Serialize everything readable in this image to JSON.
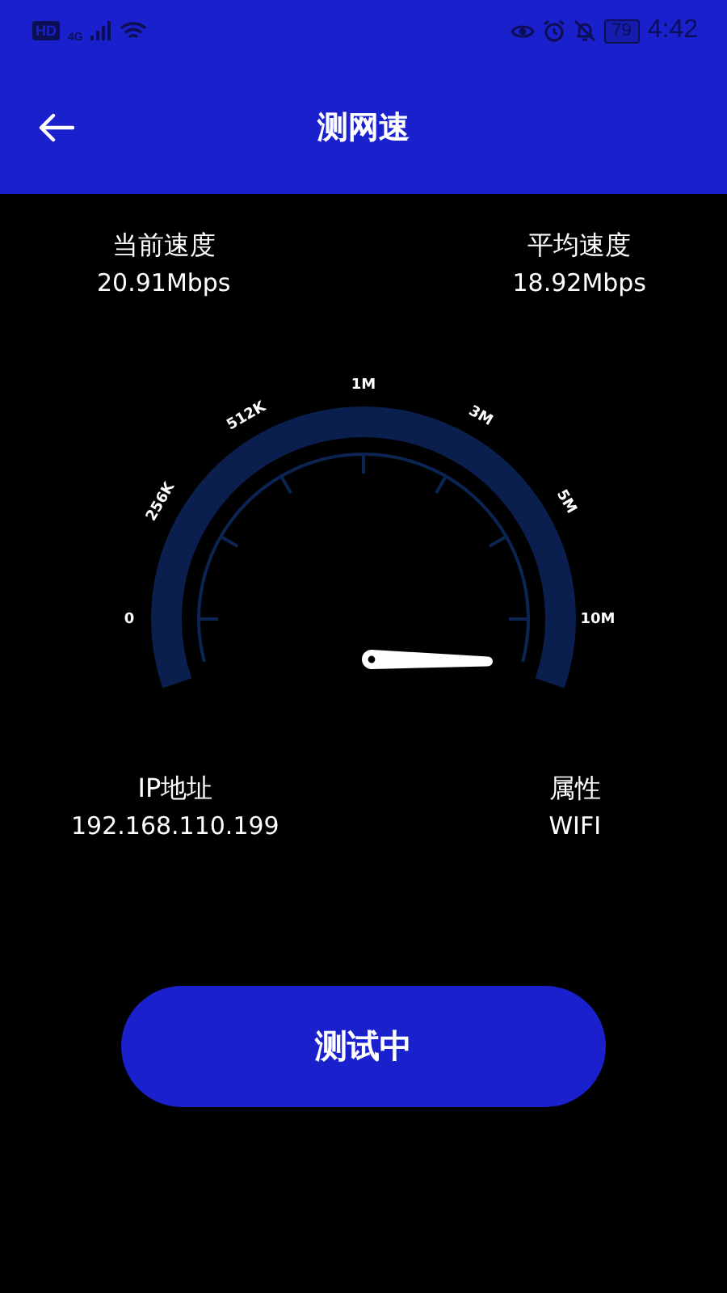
{
  "status_bar": {
    "hd": "HD",
    "network": "4G",
    "battery": "79",
    "time": "4:42"
  },
  "header": {
    "title": "测网速"
  },
  "speeds": [
    {
      "label": "当前速度",
      "value": "20.91Mbps"
    },
    {
      "label": "平均速度",
      "value": "18.92Mbps"
    }
  ],
  "gauge": {
    "scale": [
      "0",
      "256K",
      "512K",
      "1M",
      "3M",
      "5M",
      "10M"
    ]
  },
  "info": [
    {
      "label": "IP地址",
      "value": "192.168.110.199"
    },
    {
      "label": "属性",
      "value": "WIFI"
    }
  ],
  "button": {
    "label": "测试中"
  }
}
